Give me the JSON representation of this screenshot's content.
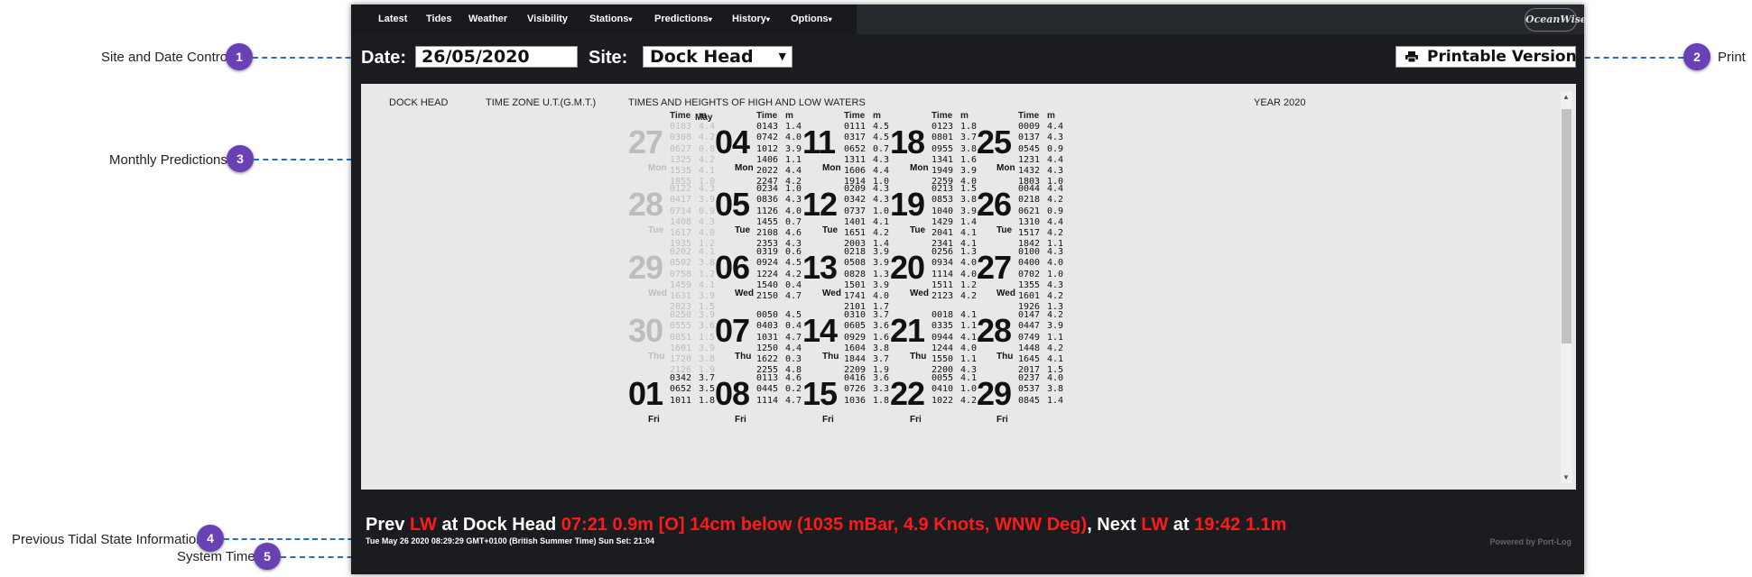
{
  "callouts": [
    {
      "num": "1",
      "label": "Site and Date Control"
    },
    {
      "num": "2",
      "label": "Print"
    },
    {
      "num": "3",
      "label": "Monthly Predictions"
    },
    {
      "num": "4",
      "label": "Previous Tidal State Information"
    },
    {
      "num": "5",
      "label": "System Time"
    }
  ],
  "nav": {
    "items": [
      "Latest",
      "Tides",
      "Weather",
      "Visibility",
      "Stations",
      "Predictions",
      "History",
      "Options"
    ],
    "caret": "▾",
    "logo": "OceanWise"
  },
  "controls": {
    "date_label": "Date:",
    "date_value": "26/05/2020",
    "site_label": "Site:",
    "site_value": "Dock Head",
    "print_label": "Printable Version"
  },
  "table": {
    "site": "DOCK HEAD",
    "timezone": "TIME ZONE U.T.(G.M.T.)",
    "title": "TIMES AND HEIGHTS OF HIGH AND LOW WATERS",
    "year": "YEAR 2020",
    "month": "May",
    "col_time": "Time",
    "col_m": "m",
    "columns": [
      [
        {
          "day": "27",
          "name": "Mon",
          "prev": true,
          "times": [
            "0103",
            "0308",
            "0627",
            "1325",
            "1535",
            "1855"
          ],
          "heights": [
            "4.4",
            "4.2",
            "0.8",
            "4.2",
            "4.1",
            "1.0"
          ]
        },
        {
          "day": "28",
          "name": "Tue",
          "prev": true,
          "times": [
            "0122",
            "0417",
            "0714",
            "1408",
            "1617",
            "1935"
          ],
          "heights": [
            "4.3",
            "3.9",
            "0.9",
            "4.3",
            "4.0",
            "1.2"
          ]
        },
        {
          "day": "29",
          "name": "Wed",
          "prev": true,
          "times": [
            "0202",
            "0502",
            "0758",
            "1459",
            "1631",
            "2023"
          ],
          "heights": [
            "4.1",
            "3.8",
            "1.2",
            "4.1",
            "3.9",
            "1.5"
          ]
        },
        {
          "day": "30",
          "name": "Thu",
          "prev": true,
          "times": [
            "0250",
            "0555",
            "0851",
            "1601",
            "1720",
            "2126"
          ],
          "heights": [
            "3.9",
            "3.6",
            "1.5",
            "3.9",
            "3.8",
            "1.9"
          ]
        },
        {
          "day": "01",
          "name": "Fri",
          "prev": false,
          "times": [
            "0342",
            "0652",
            "1011"
          ],
          "heights": [
            "3.7",
            "3.5",
            "1.8"
          ]
        }
      ],
      [
        {
          "day": "04",
          "name": "Mon",
          "prev": false,
          "times": [
            "0143",
            "0742",
            "1012",
            "1406",
            "2022",
            "2247"
          ],
          "heights": [
            "1.4",
            "4.0",
            "3.9",
            "1.1",
            "4.4",
            "4.2"
          ]
        },
        {
          "day": "05",
          "name": "Tue",
          "prev": false,
          "times": [
            "0234",
            "0836",
            "1126",
            "1455",
            "2108",
            "2353"
          ],
          "heights": [
            "1.0",
            "4.3",
            "4.0",
            "0.7",
            "4.6",
            "4.3"
          ]
        },
        {
          "day": "06",
          "name": "Wed",
          "prev": false,
          "times": [
            "0319",
            "0924",
            "1224",
            "1540",
            "2150"
          ],
          "heights": [
            "0.6",
            "4.5",
            "4.2",
            "0.4",
            "4.7"
          ]
        },
        {
          "day": "07",
          "name": "Thu",
          "prev": false,
          "times": [
            "0050",
            "0403",
            "1031",
            "1250",
            "1622",
            "2255"
          ],
          "heights": [
            "4.5",
            "0.4",
            "4.7",
            "4.4",
            "0.3",
            "4.8"
          ]
        },
        {
          "day": "08",
          "name": "Fri",
          "prev": false,
          "times": [
            "0113",
            "0445",
            "1114"
          ],
          "heights": [
            "4.6",
            "0.2",
            "4.7"
          ]
        }
      ],
      [
        {
          "day": "11",
          "name": "Mon",
          "prev": false,
          "times": [
            "0111",
            "0317",
            "0652",
            "1311",
            "1606",
            "1914"
          ],
          "heights": [
            "4.5",
            "4.5",
            "0.7",
            "4.3",
            "4.4",
            "1.0"
          ]
        },
        {
          "day": "12",
          "name": "Tue",
          "prev": false,
          "times": [
            "0209",
            "0342",
            "0737",
            "1401",
            "1651",
            "2003"
          ],
          "heights": [
            "4.3",
            "4.3",
            "1.0",
            "4.1",
            "4.2",
            "1.4"
          ]
        },
        {
          "day": "13",
          "name": "Wed",
          "prev": false,
          "times": [
            "0218",
            "0508",
            "0828",
            "1501",
            "1741",
            "2101"
          ],
          "heights": [
            "3.9",
            "3.9",
            "1.3",
            "3.9",
            "4.0",
            "1.7"
          ]
        },
        {
          "day": "14",
          "name": "Thu",
          "prev": false,
          "times": [
            "0310",
            "0605",
            "0929",
            "1604",
            "1844",
            "2209"
          ],
          "heights": [
            "3.7",
            "3.6",
            "1.6",
            "3.8",
            "3.7",
            "1.9"
          ]
        },
        {
          "day": "15",
          "name": "Fri",
          "prev": false,
          "times": [
            "0416",
            "0726",
            "1036"
          ],
          "heights": [
            "3.6",
            "3.3",
            "1.8"
          ]
        }
      ],
      [
        {
          "day": "18",
          "name": "Mon",
          "prev": false,
          "times": [
            "0123",
            "0801",
            "0955",
            "1341",
            "1949",
            "2259"
          ],
          "heights": [
            "1.8",
            "3.7",
            "3.8",
            "1.6",
            "3.9",
            "4.0"
          ]
        },
        {
          "day": "19",
          "name": "Tue",
          "prev": false,
          "times": [
            "0213",
            "0853",
            "1040",
            "1429",
            "2041",
            "2341"
          ],
          "heights": [
            "1.5",
            "3.8",
            "3.9",
            "1.4",
            "4.1",
            "4.1"
          ]
        },
        {
          "day": "20",
          "name": "Wed",
          "prev": false,
          "times": [
            "0256",
            "0934",
            "1114",
            "1511",
            "2123"
          ],
          "heights": [
            "1.3",
            "4.0",
            "4.0",
            "1.2",
            "4.2"
          ]
        },
        {
          "day": "21",
          "name": "Thu",
          "prev": false,
          "times": [
            "0018",
            "0335",
            "0944",
            "1244",
            "1550",
            "2200"
          ],
          "heights": [
            "4.1",
            "1.1",
            "4.1",
            "4.0",
            "1.1",
            "4.3"
          ]
        },
        {
          "day": "22",
          "name": "Fri",
          "prev": false,
          "times": [
            "0055",
            "0410",
            "1022"
          ],
          "heights": [
            "4.1",
            "1.0",
            "4.2"
          ]
        }
      ],
      [
        {
          "day": "25",
          "name": "Mon",
          "prev": false,
          "times": [
            "0009",
            "0137",
            "0545",
            "1231",
            "1432",
            "1803"
          ],
          "heights": [
            "4.4",
            "4.3",
            "0.9",
            "4.4",
            "4.3",
            "1.0"
          ]
        },
        {
          "day": "26",
          "name": "Tue",
          "prev": false,
          "times": [
            "0044",
            "0218",
            "0621",
            "1310",
            "1517",
            "1842"
          ],
          "heights": [
            "4.4",
            "4.2",
            "0.9",
            "4.4",
            "4.2",
            "1.1"
          ]
        },
        {
          "day": "27",
          "name": "Wed",
          "prev": false,
          "times": [
            "0100",
            "0400",
            "0702",
            "1355",
            "1601",
            "1926"
          ],
          "heights": [
            "4.3",
            "4.0",
            "1.0",
            "4.3",
            "4.2",
            "1.3"
          ]
        },
        {
          "day": "28",
          "name": "Thu",
          "prev": false,
          "times": [
            "0147",
            "0447",
            "0749",
            "1448",
            "1645",
            "2017"
          ],
          "heights": [
            "4.2",
            "3.9",
            "1.1",
            "4.2",
            "4.1",
            "1.5"
          ]
        },
        {
          "day": "29",
          "name": "Fri",
          "prev": false,
          "times": [
            "0237",
            "0537",
            "0845"
          ],
          "heights": [
            "4.0",
            "3.8",
            "1.4"
          ]
        }
      ]
    ]
  },
  "status": {
    "prev": "Prev",
    "prev_state": "LW",
    "at1": "at Dock Head",
    "prev_detail": "07:21 0.9m [O] 14cm below (1035 mBar, 4.9 Knots, WNW Deg)",
    "next": ", Next",
    "next_state": "LW",
    "at2": "at",
    "next_detail": "19:42 1.1m"
  },
  "system_time": "Tue May 26 2020 08:29:29 GMT+0100 (British Summer Time) Sun Set: 21:04",
  "powered_by": "Powered by Port-Log"
}
